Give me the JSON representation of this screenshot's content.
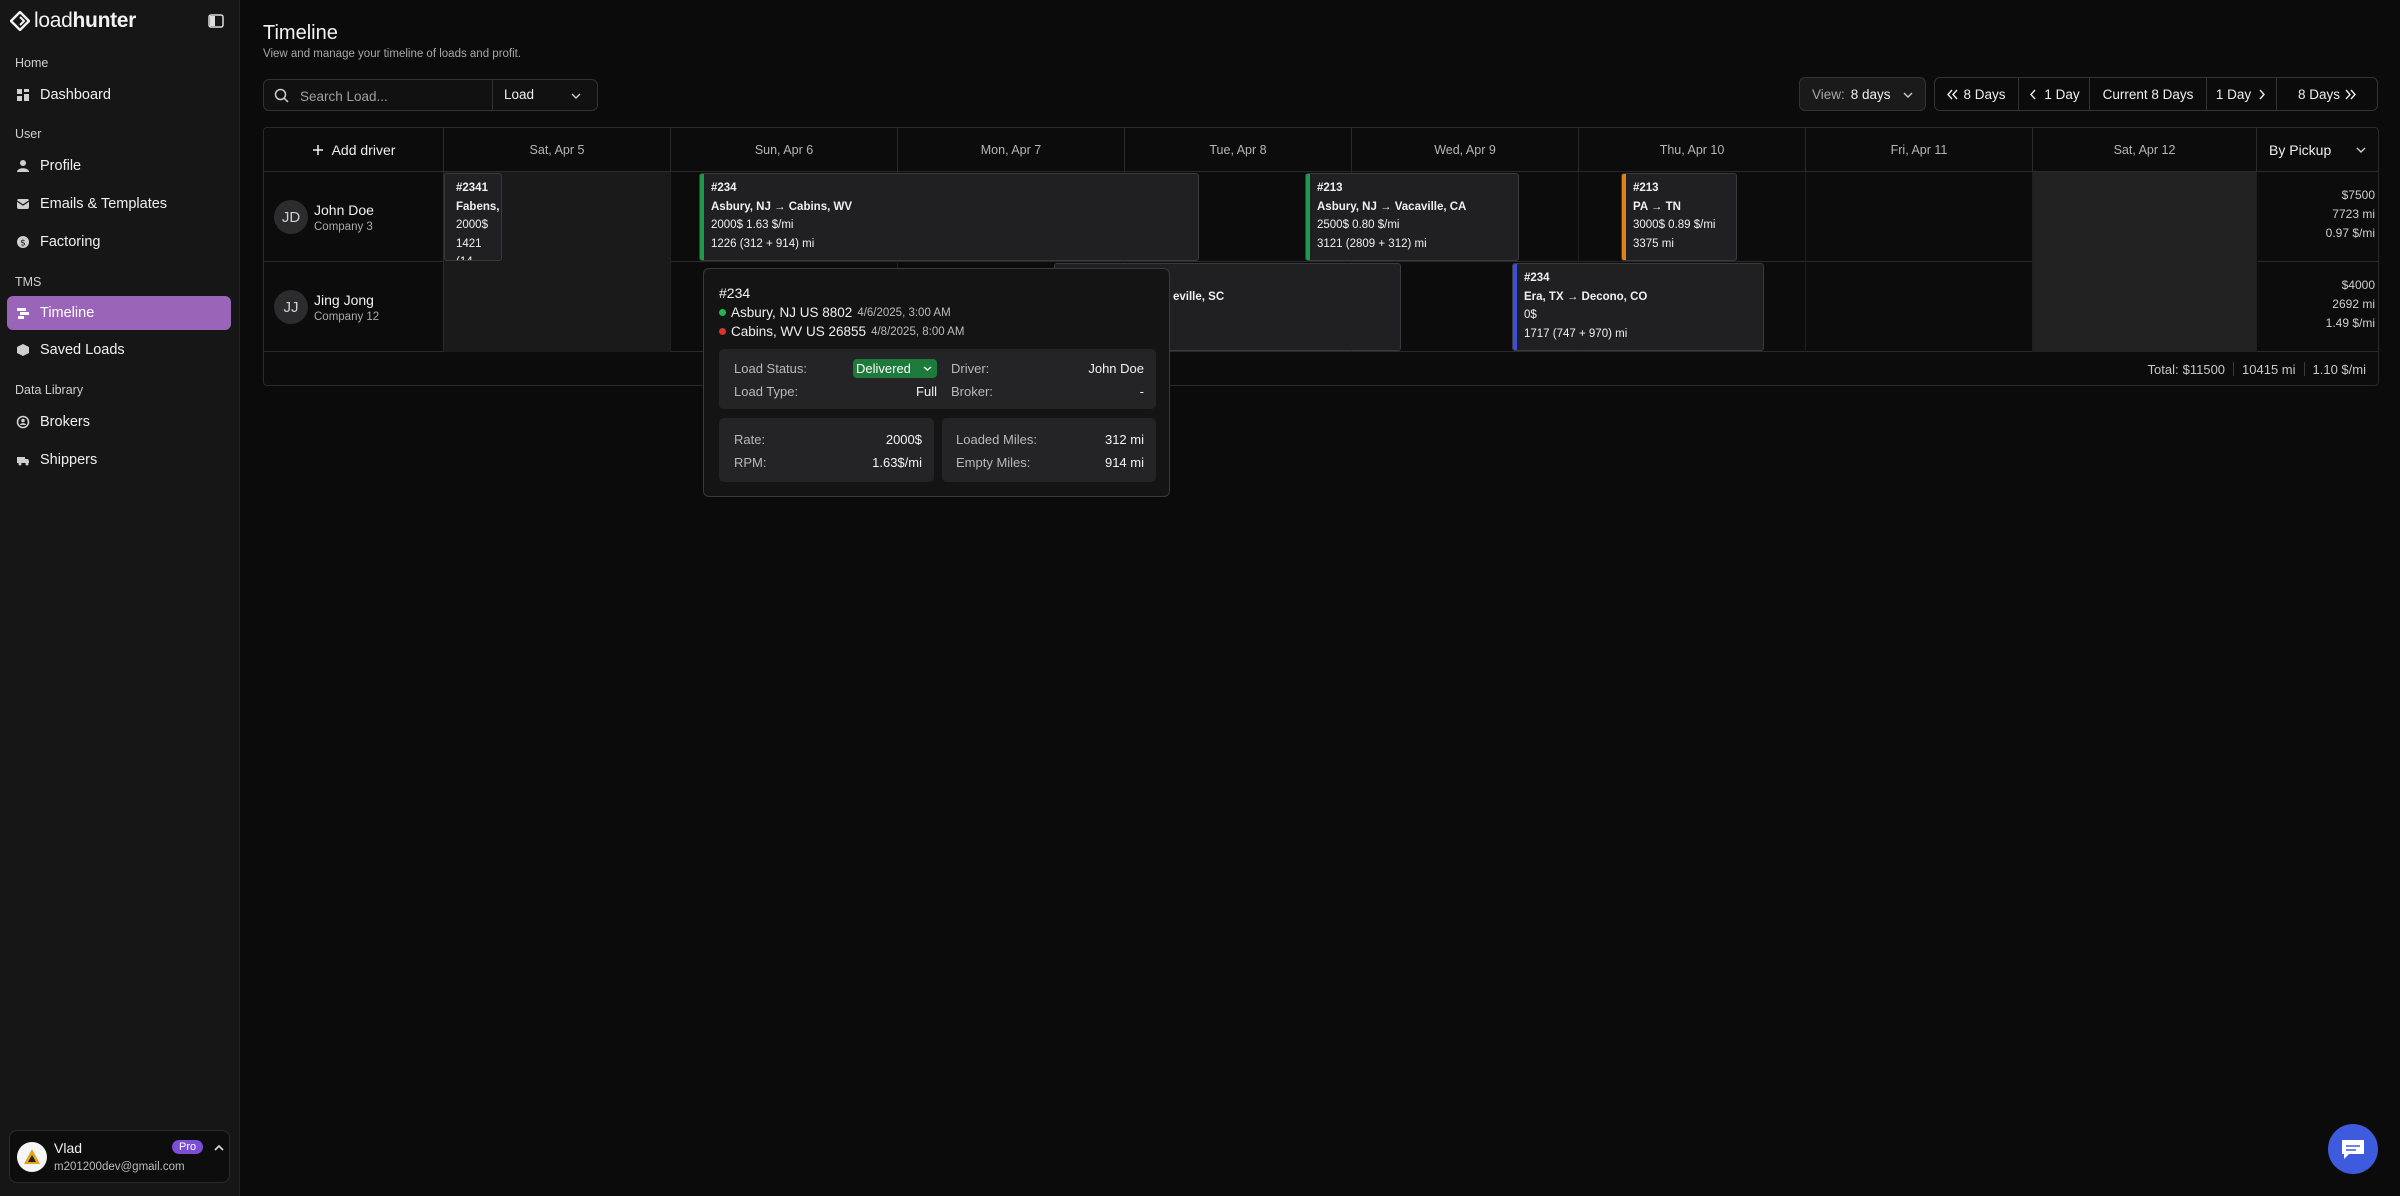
{
  "brand": {
    "name_light": "load",
    "name_bold": "hunter"
  },
  "sidebar": {
    "groups": [
      {
        "label": "Home",
        "items": [
          {
            "label": "Dashboard",
            "icon": "dashboard-icon"
          }
        ]
      },
      {
        "label": "User",
        "items": [
          {
            "label": "Profile",
            "icon": "user-icon"
          },
          {
            "label": "Emails & Templates",
            "icon": "mail-icon"
          },
          {
            "label": "Factoring",
            "icon": "dollar-icon"
          }
        ]
      },
      {
        "label": "TMS",
        "items": [
          {
            "label": "Timeline",
            "icon": "timeline-icon",
            "active": true
          },
          {
            "label": "Saved Loads",
            "icon": "box-icon"
          }
        ]
      },
      {
        "label": "Data Library",
        "items": [
          {
            "label": "Brokers",
            "icon": "broker-icon"
          },
          {
            "label": "Shippers",
            "icon": "truck-icon"
          }
        ]
      }
    ],
    "user": {
      "name": "Vlad",
      "email": "m201200dev@gmail.com",
      "plan": "Pro"
    }
  },
  "header": {
    "title": "Timeline",
    "subtitle": "View and manage your timeline of loads and profit."
  },
  "search": {
    "placeholder": "Search Load...",
    "type_value": "Load"
  },
  "view": {
    "label": "View:",
    "value": "8 days"
  },
  "nav_buttons": [
    "8 Days",
    "1 Day",
    "Current 8 Days",
    "1 Day",
    "8 Days"
  ],
  "grid": {
    "add_driver_label": "Add driver",
    "sort_label": "By Pickup",
    "days": [
      "Sat, Apr 5",
      "Sun, Apr 6",
      "Mon, Apr 7",
      "Tue, Apr 8",
      "Wed, Apr 9",
      "Thu, Apr 10",
      "Fri, Apr 11",
      "Sat, Apr 12"
    ],
    "drivers": [
      {
        "initials": "JD",
        "name": "John Doe",
        "company": "Company 3",
        "summary": {
          "profit": "$7500",
          "miles": "7723 mi",
          "rpm": "0.97 $/mi"
        },
        "loads": [
          {
            "id": "#2341",
            "route": "Fabens, ",
            "rate": "2000$ ",
            "miles": "1421 (14",
            "color": "#2f2f31"
          },
          {
            "id": "#234",
            "route": "Asbury, NJ → Cabins, WV",
            "rate": "2000$ 1.63 $/mi",
            "miles": "1226 (312 + 914) mi",
            "color": "#1f9a4a"
          },
          {
            "id": "#213",
            "route": "Asbury, NJ → Vacaville, CA",
            "rate": "2500$ 0.80 $/mi",
            "miles": "3121 (2809 + 312) mi",
            "color": "#1f9a4a"
          },
          {
            "id": "#213",
            "route": "PA → TN",
            "rate": "3000$ 0.89 $/mi",
            "miles": "3375 mi",
            "color": "#e0821c"
          }
        ]
      },
      {
        "initials": "JJ",
        "name": "Jing Jong",
        "company": "Company 12",
        "summary": {
          "profit": "$4000",
          "miles": "2692 mi",
          "rpm": "1.49 $/mi"
        },
        "loads": [
          {
            "route": "eville, SC"
          },
          {
            "id": "#234",
            "route": "Era, TX → Decono, CO",
            "rate": "0$",
            "miles": "1717 (747 + 970) mi",
            "color": "#3b4fd8"
          }
        ]
      }
    ],
    "totals": {
      "label": "Total:",
      "profit": "$11500",
      "miles": "10415 mi",
      "rpm": "1.10 $/mi"
    }
  },
  "tooltip": {
    "id": "#234",
    "pickup": {
      "place": "Asbury, NJ US 8802",
      "time": "4/6/2025, 3:00 AM"
    },
    "dropoff": {
      "place": "Cabins, WV US 26855",
      "time": "4/8/2025, 8:00 AM"
    },
    "load_status_label": "Load Status:",
    "load_status": "Delivered",
    "load_type_label": "Load Type:",
    "load_type": "Full",
    "driver_label": "Driver:",
    "driver": "John Doe",
    "broker_label": "Broker:",
    "broker": "-",
    "rate_label": "Rate:",
    "rate": "2000$",
    "rpm_label": "RPM:",
    "rpm": "1.63$/mi",
    "loaded_label": "Loaded Miles:",
    "loaded": "312 mi",
    "empty_label": "Empty Miles:",
    "empty": "914 mi"
  },
  "colors": {
    "accent": "#9a64b8",
    "pro_badge": "#7c4dd6",
    "delivered": "#1d7a3a",
    "chat": "#3d5bdc"
  }
}
